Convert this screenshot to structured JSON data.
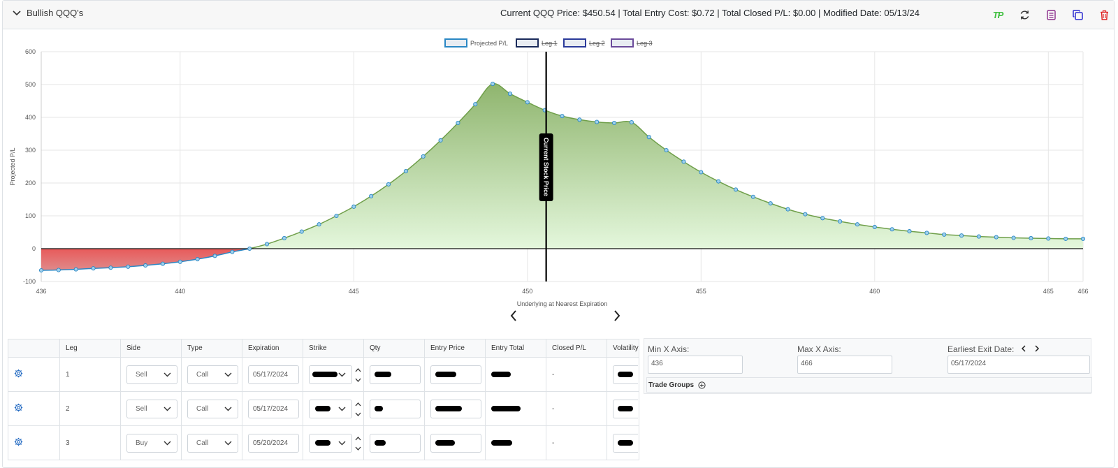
{
  "header": {
    "group_name": "Bullish QQQ's",
    "summary": "Current QQQ Price: $450.54 | Total Entry Cost: $0.72 | Total Closed P/L: $0.00 | Modified Date: 05/13/24",
    "tp_logo": "TP",
    "icons": [
      "chevron-down-icon",
      "tp-logo-icon",
      "refresh-icon",
      "notes-icon",
      "copy-icon",
      "trash-icon"
    ]
  },
  "chart_data": {
    "type": "line",
    "title": "",
    "xlabel": "Underlying at Nearest Expiration",
    "ylabel": "Projected P/L",
    "xlim": [
      436,
      466
    ],
    "ylim": [
      -100,
      600
    ],
    "x_ticks": [
      "436",
      "440",
      "445",
      "450",
      "455",
      "460",
      "465",
      "466"
    ],
    "y_ticks": [
      "600",
      "500",
      "400",
      "300",
      "200",
      "100",
      "0",
      "-100"
    ],
    "legend": [
      {
        "name": "Projected P/L",
        "strike": false,
        "color": "#2a87c4"
      },
      {
        "name": "Leg 1",
        "strike": true,
        "color": "#1a2a5a"
      },
      {
        "name": "Leg 2",
        "strike": true,
        "color": "#2a3a9a"
      },
      {
        "name": "Leg 3",
        "strike": true,
        "color": "#6a4a9a"
      }
    ],
    "current_price_label": "Current Stock Price",
    "current_price": 450.54,
    "series": [
      {
        "name": "Projected P/L",
        "x": [
          436,
          436.5,
          437,
          437.5,
          438,
          438.5,
          439,
          439.5,
          440,
          440.5,
          441,
          441.5,
          442,
          442.5,
          443,
          443.5,
          444,
          444.5,
          445,
          445.5,
          446,
          446.5,
          447,
          447.5,
          448,
          448.5,
          449,
          449.5,
          450,
          450.5,
          451,
          451.5,
          452,
          452.5,
          453,
          453.5,
          454,
          454.5,
          455,
          455.5,
          456,
          456.5,
          457,
          457.5,
          458,
          458.5,
          459,
          459.5,
          460,
          460.5,
          461,
          461.5,
          462,
          462.5,
          463,
          463.5,
          464,
          464.5,
          465,
          465.5,
          466
        ],
        "y": [
          -66,
          -65,
          -63,
          -60,
          -58,
          -55,
          -51,
          -46,
          -40,
          -32,
          -22,
          -10,
          0,
          14,
          32,
          52,
          74,
          100,
          128,
          160,
          196,
          236,
          281,
          330,
          383,
          440,
          502,
          472,
          446,
          422,
          404,
          393,
          386,
          383,
          385,
          340,
          300,
          265,
          233,
          205,
          180,
          158,
          138,
          120,
          105,
          93,
          83,
          74,
          66,
          59,
          53,
          48,
          43,
          40,
          37,
          35,
          33,
          32,
          31,
          30,
          30
        ]
      }
    ]
  },
  "legs_table": {
    "headers": [
      "",
      "Leg",
      "Side",
      "Type",
      "Expiration",
      "Strike",
      "Qty",
      "Entry Price",
      "Entry Total",
      "Closed P/L",
      "Volatility"
    ],
    "rows": [
      {
        "leg": "1",
        "side": "Sell",
        "type": "Call",
        "expiration": "05/17/2024",
        "closed_pl": "-"
      },
      {
        "leg": "2",
        "side": "Sell",
        "type": "Call",
        "expiration": "05/17/2024",
        "closed_pl": "-"
      },
      {
        "leg": "3",
        "side": "Buy",
        "type": "Call",
        "expiration": "05/20/2024",
        "closed_pl": "-"
      }
    ]
  },
  "settings": {
    "min_x_label": "Min X Axis:",
    "min_x_value": "436",
    "max_x_label": "Max X Axis:",
    "max_x_value": "466",
    "earliest_exit_label": "Earliest Exit Date:",
    "earliest_exit_value": "05/17/2024",
    "trade_groups_label": "Trade Groups"
  }
}
